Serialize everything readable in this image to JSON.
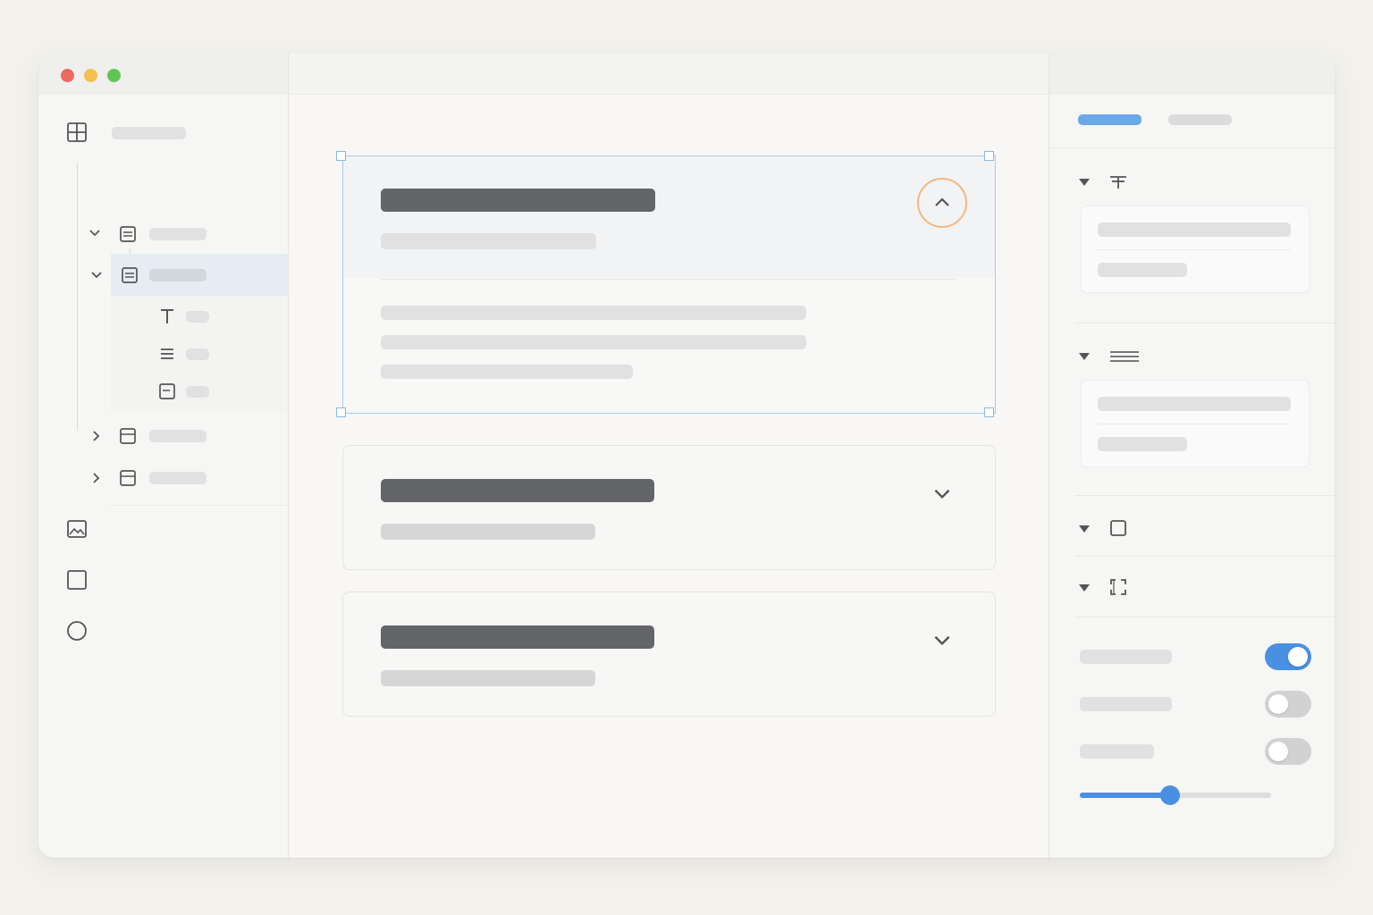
{
  "colors": {
    "accent": "#4a90e2",
    "selection_border": "#a9cbea",
    "focus_ring": "#f4b780",
    "traffic_red": "#ed6a5e",
    "traffic_yellow": "#f5bf4f",
    "traffic_green": "#61c554"
  },
  "icons": {
    "sidebar_top": "grid-icon",
    "tree_frames": "frame-icon",
    "tree_children": [
      "text-icon",
      "list-icon",
      "frame-icon"
    ],
    "tools": [
      "image-icon",
      "square-icon",
      "circle-icon"
    ],
    "panel_sections": [
      "text-align-icon",
      "lines-icon",
      "square-icon",
      "corners-icon"
    ],
    "accordion_expanded": "chevron-up-icon",
    "accordion_collapsed": "chevron-down-icon"
  },
  "inspector": {
    "toggles": [
      true,
      false,
      false
    ],
    "slider_value_percent": 47
  }
}
